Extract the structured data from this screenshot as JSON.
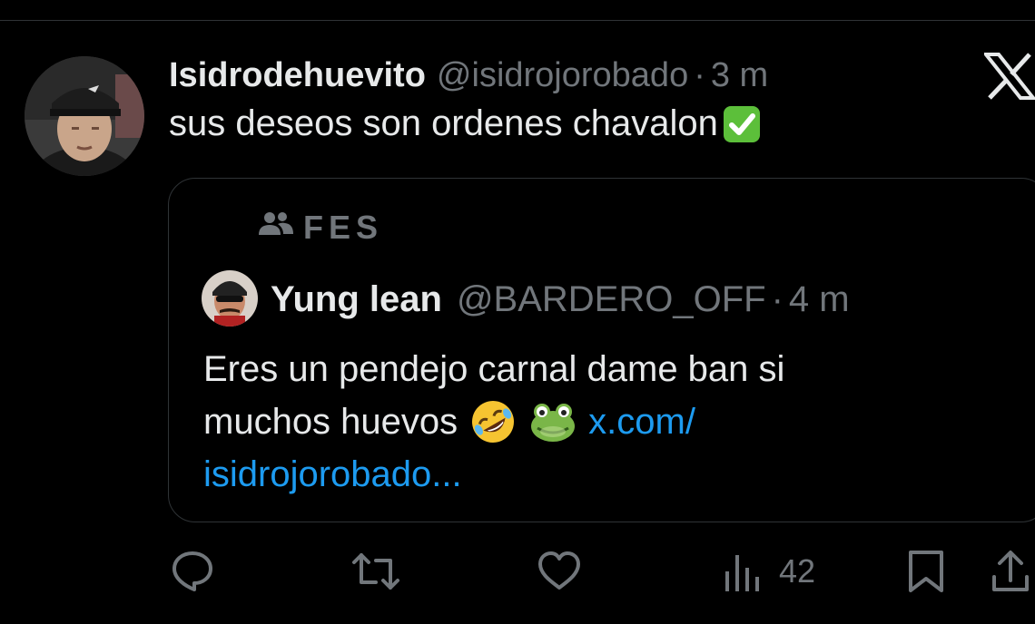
{
  "post": {
    "display_name": "Isidrodehuevito",
    "handle": "@isidrojorobado",
    "separator": "·",
    "time": "3 m",
    "text": "sus deseos son ordenes chavalon"
  },
  "quote": {
    "community_name": "FES",
    "display_name": "Yung lean",
    "handle": "@BARDERO_OFF",
    "separator": "·",
    "time": "4 m",
    "text_line1": "Eres un pendejo carnal dame ban si",
    "text_line2": "muchos huevos",
    "link_part1": "x.com/",
    "link_part2": "isidrojorobado..."
  },
  "actions": {
    "views_count": "42"
  },
  "icons": {
    "logo": "x-logo-icon",
    "check": "check-mark-button-emoji",
    "community": "community-icon",
    "emoji_laugh": "rolling-on-floor-laughing-emoji",
    "emoji_frog": "frog-face-emoji",
    "reply": "reply-icon",
    "repost": "repost-icon",
    "like": "heart-icon",
    "views": "views-icon",
    "bookmark": "bookmark-icon",
    "share": "share-icon"
  },
  "colors": {
    "background": "#000000",
    "text": "#e7e9ea",
    "secondary": "#71767b",
    "link": "#1d9bf0",
    "border": "#2f3336"
  }
}
